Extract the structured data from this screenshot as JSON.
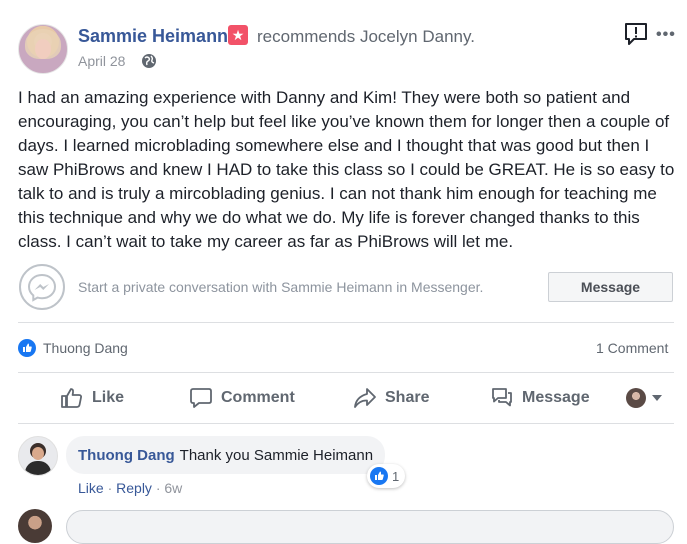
{
  "post": {
    "author": "Sammie Heimann",
    "badge_icon": "star-badge",
    "action_text": "recommends Jocelyn Danny.",
    "date": "April 28",
    "privacy_icon": "globe-icon",
    "body": "I had an amazing experience with Danny and Kim! They were both so patient and encouraging, you can’t help but feel like you’ve known them for longer then a couple of days. I learned microblading somewhere else and I thought that was good but then I saw PhiBrows and knew I HAD to take this class so I could be GREAT. He is so easy to talk to and is truly a mircoblading genius. I can not thank him enough for teaching me this technique and why we do what we do. My life is forever changed thanks to this class. I can’t wait to take my career as far as PhiBrows will let me."
  },
  "messenger": {
    "prompt": "Start a private conversation with Sammie Heimann in Messenger.",
    "button_label": "Message"
  },
  "reactions": {
    "liker": "Thuong Dang",
    "comment_count": "1 Comment"
  },
  "actions": {
    "like": "Like",
    "comment": "Comment",
    "share": "Share",
    "message": "Message"
  },
  "comment": {
    "author": "Thuong Dang",
    "text": "Thank you Sammie Heimann",
    "reaction_count": "1",
    "like_label": "Like",
    "reply_label": "Reply",
    "age": "6w"
  },
  "colors": {
    "link_blue": "#385898",
    "fb_blue": "#1877f2",
    "badge_red": "#f25268",
    "muted": "#606770"
  }
}
